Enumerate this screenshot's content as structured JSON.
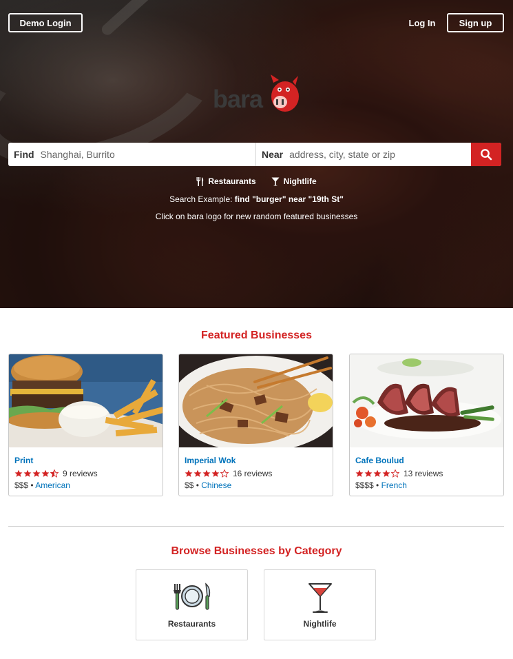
{
  "header": {
    "demo_login": "Demo Login",
    "log_in": "Log In",
    "sign_up": "Sign up"
  },
  "logo": {
    "text": "bara"
  },
  "search": {
    "find_label": "Find",
    "find_placeholder": "Shanghai, Burrito",
    "near_label": "Near",
    "near_placeholder": "address, city, state or zip",
    "button_icon": "search-icon"
  },
  "quick_links": [
    {
      "label": "Restaurants",
      "icon": "fork-knife-icon"
    },
    {
      "label": "Nightlife",
      "icon": "cocktail-icon"
    }
  ],
  "hints": {
    "example_prefix": "Search Example: ",
    "example_query": "find \"burger\" near \"19th St\"",
    "random_tip": "Click on bara logo for new random featured businesses"
  },
  "featured": {
    "title": "Featured Businesses",
    "businesses": [
      {
        "name": "Print",
        "rating": 4.5,
        "reviews": "9 reviews",
        "price": "$$$",
        "separator": " • ",
        "category": "American"
      },
      {
        "name": "Imperial Wok",
        "rating": 4,
        "reviews": "16 reviews",
        "price": "$$",
        "separator": " • ",
        "category": "Chinese"
      },
      {
        "name": "Cafe Boulud",
        "rating": 4,
        "reviews": "13 reviews",
        "price": "$$$$",
        "separator": " • ",
        "category": "French"
      }
    ]
  },
  "browse": {
    "title": "Browse Businesses by Category",
    "categories": [
      {
        "label": "Restaurants",
        "icon": "plate-cutlery-icon"
      },
      {
        "label": "Nightlife",
        "icon": "martini-icon"
      }
    ]
  },
  "colors": {
    "brand_red": "#d32323",
    "link_blue": "#0073bb",
    "star_red": "#d32323"
  }
}
